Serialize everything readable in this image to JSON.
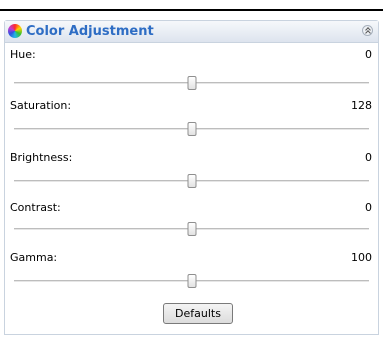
{
  "panel": {
    "title": "Color Adjustment",
    "icon": "color-wheel-icon",
    "collapse_icon": "double-chevron-up-icon"
  },
  "sliders": [
    {
      "key": "hue",
      "label": "Hue:",
      "value": "0",
      "min": -180,
      "max": 180
    },
    {
      "key": "saturation",
      "label": "Saturation:",
      "value": "128",
      "min": 0,
      "max": 256
    },
    {
      "key": "brightness",
      "label": "Brightness:",
      "value": "0",
      "min": -255,
      "max": 255
    },
    {
      "key": "contrast",
      "label": "Contrast:",
      "value": "0",
      "min": -100,
      "max": 100
    },
    {
      "key": "gamma",
      "label": "Gamma:",
      "value": "100",
      "min": 0,
      "max": 200
    }
  ],
  "footer": {
    "defaults_label": "Defaults"
  },
  "colors": {
    "title_text": "#2e6dc4",
    "panel_border": "#c9d3df"
  }
}
